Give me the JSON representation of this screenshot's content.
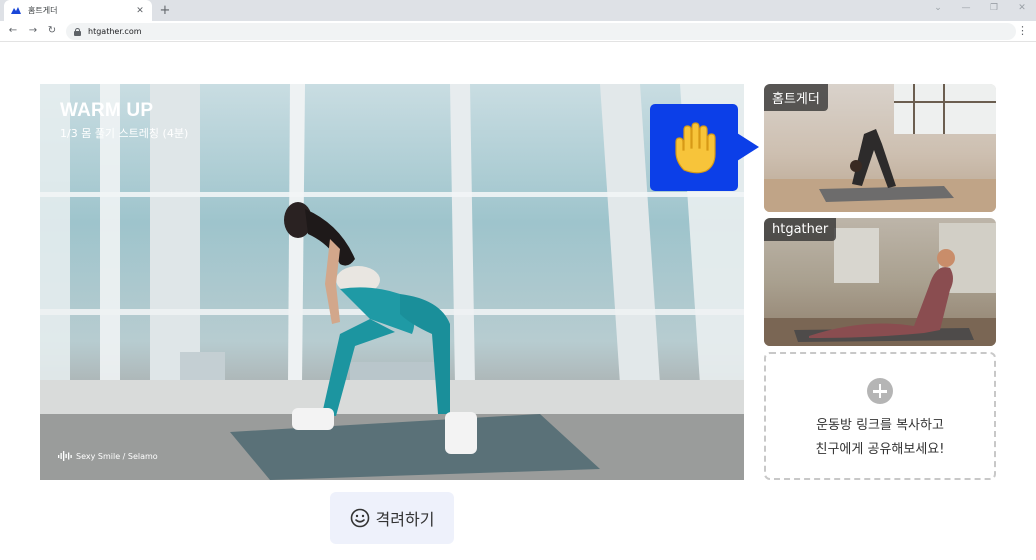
{
  "browser": {
    "tab_title": "홈트게더",
    "tab_close": "✕",
    "new_tab": "+",
    "url": "htgather.com",
    "nav_back": "←",
    "nav_forward": "→",
    "nav_reload": "↻",
    "menu": "⋮",
    "win_dropdown": "⌄",
    "win_minimize": "—",
    "win_restore": "❐",
    "win_close": "✕"
  },
  "workout": {
    "title": "WARM UP",
    "subtitle": "1/3 몸 풀기 스트레칭 (4분)",
    "music": "Sexy Smile / Selamo"
  },
  "cheer_button": {
    "label": "격려하기",
    "icon": "smiley-icon"
  },
  "hand_bubble": {
    "icon": "raised-hand-icon",
    "color": "#0c3fe8"
  },
  "participants": [
    {
      "name": "홈트게더"
    },
    {
      "name": "htgather"
    }
  ],
  "invite": {
    "icon": "plus-circle-icon",
    "line1": "운동방 링크를 복사하고",
    "line2": "친구에게 공유해보세요!"
  }
}
